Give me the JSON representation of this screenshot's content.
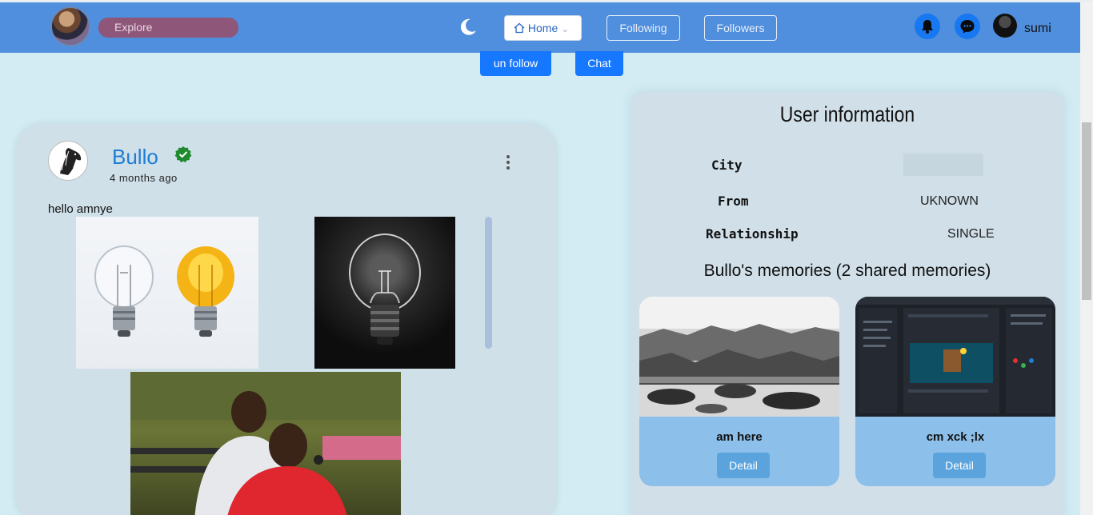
{
  "navbar": {
    "explore_label": "Explore",
    "home_label": "Home",
    "following_label": "Following",
    "followers_label": "Followers",
    "username": "sumi",
    "bar_color": "#508fdd",
    "accent_color": "#1778f2"
  },
  "profile_actions": {
    "unfollow_label": "un follow",
    "chat_label": "Chat"
  },
  "post": {
    "author": "Bullo",
    "time": "4 months ago",
    "text": "hello amnye"
  },
  "user_info": {
    "title": "User information",
    "rows": [
      {
        "label": "City",
        "value": ""
      },
      {
        "label": "From",
        "value": "UKNOWN"
      },
      {
        "label": "Relationship",
        "value": "SINGLE"
      }
    ]
  },
  "memories": {
    "title": "Bullo's memories (2 shared memories)",
    "items": [
      {
        "caption": "am here",
        "button": "Detail"
      },
      {
        "caption": "cm xck ;lx",
        "button": "Detail"
      }
    ]
  }
}
